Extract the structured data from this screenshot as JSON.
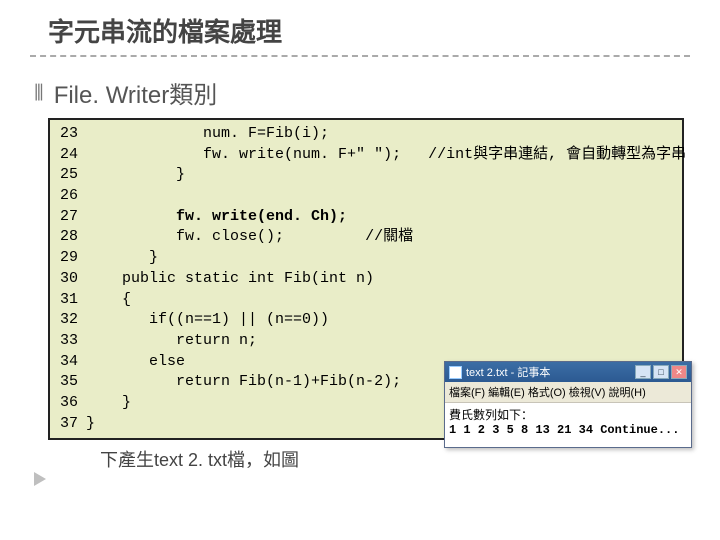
{
  "title": "字元串流的檔案處理",
  "bullet_glyph": "⦀",
  "subtitle": "File. Writer類別",
  "code": {
    "line_numbers": [
      "23",
      "24",
      "25",
      "26",
      "27",
      "28",
      "29",
      "30",
      "31",
      "32",
      "33",
      "34",
      "35",
      "36",
      "37"
    ],
    "l23": "             num. F=Fib(i);",
    "l24a": "             fw. write(num. F+\" \");   ",
    "l24b": "//int與字串連結, 會自動轉型為字串",
    "l25": "          }",
    "l26": "",
    "l27": "          fw. write(end. Ch);",
    "l28a": "          fw. close();         ",
    "l28b": "//關檔",
    "l29": "       }",
    "l30": "    public static int Fib(int n)",
    "l31": "    {",
    "l32": "       if((n==1) || (n==0))",
    "l33": "          return n;",
    "l34": "       else",
    "l35": "          return Fib(n-1)+Fib(n-2);",
    "l36": "    }",
    "l37": "}"
  },
  "caption": "下產生text 2. txt檔，如圖",
  "notepad": {
    "title": "text 2.txt - 記事本",
    "menu": "檔案(F)  編輯(E)  格式(O)  檢視(V)  說明(H)",
    "line1": "費氏數列如下：",
    "line2": "1 1 2 3 5 8 13 21 34 Continue...",
    "btn_min": "_",
    "btn_max": "□",
    "btn_close": "✕"
  }
}
